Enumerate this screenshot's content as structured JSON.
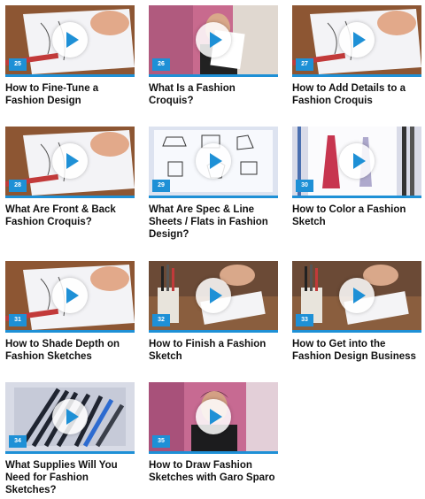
{
  "accent_color": "#1e90d6",
  "videos": [
    {
      "number": "25",
      "title": "How to Fine-Tune a Fashion Design",
      "thumb": "sketch-table"
    },
    {
      "number": "26",
      "title": "What Is a Fashion Croquis?",
      "thumb": "presenter-paper"
    },
    {
      "number": "27",
      "title": "How to Add Details to a Fashion Croquis",
      "thumb": "sketch-table"
    },
    {
      "number": "28",
      "title": "What Are Front & Back Fashion Croquis?",
      "thumb": "sketch-table"
    },
    {
      "number": "29",
      "title": "What Are Spec & Line Sheets / Flats in Fashion Design?",
      "thumb": "flats-sheet"
    },
    {
      "number": "30",
      "title": "How to Color a Fashion Sketch",
      "thumb": "colored-sketch"
    },
    {
      "number": "31",
      "title": "How to Shade Depth on Fashion Sketches",
      "thumb": "sketch-table"
    },
    {
      "number": "32",
      "title": "How to Finish a Fashion Sketch",
      "thumb": "supplies"
    },
    {
      "number": "33",
      "title": "How to Get into the Fashion Design Business",
      "thumb": "supplies"
    },
    {
      "number": "34",
      "title": "What Supplies Will You Need for Fashion Sketches?",
      "thumb": "pens-box"
    },
    {
      "number": "35",
      "title": "How to Draw Fashion Sketches with Garo Sparo",
      "thumb": "presenter"
    }
  ]
}
